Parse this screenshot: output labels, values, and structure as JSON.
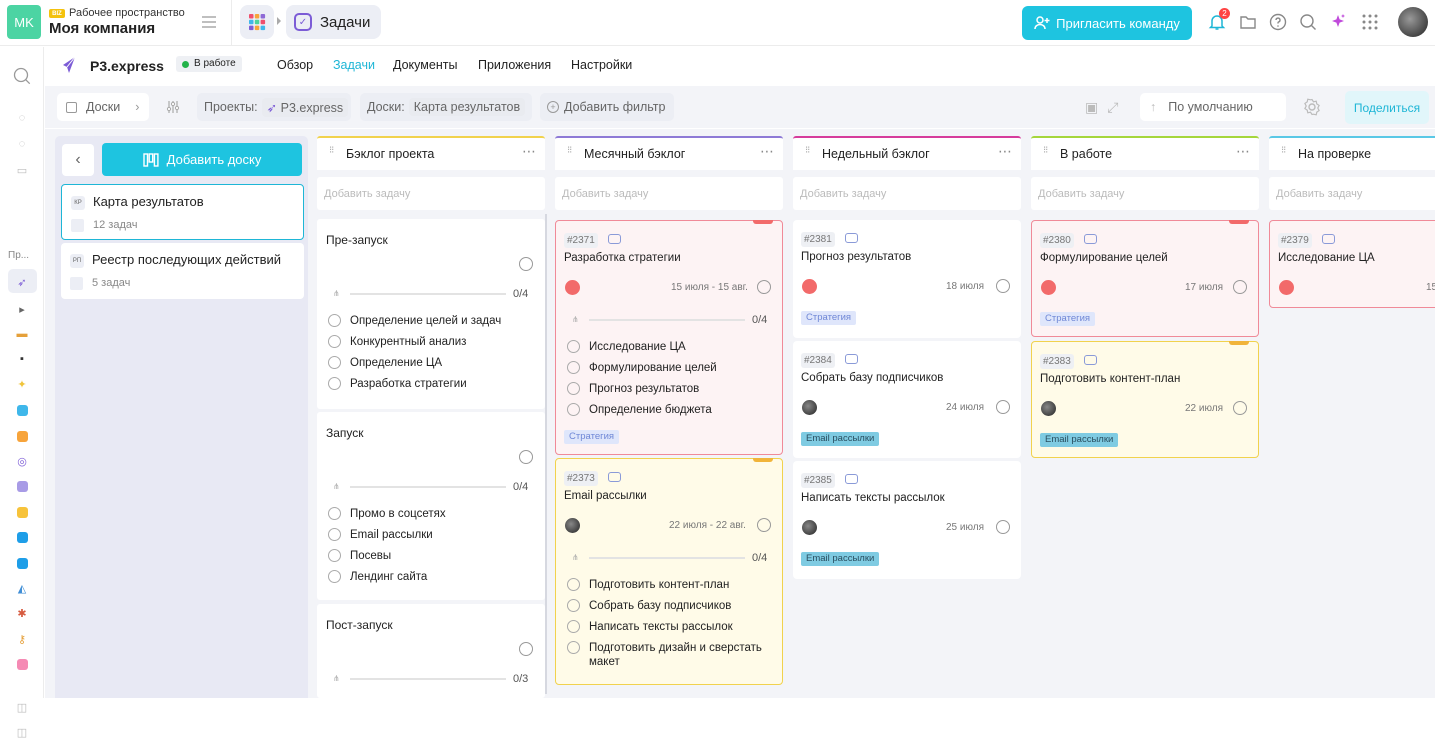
{
  "topbar": {
    "avatar_initials": "MK",
    "ws_badge": "BIZ",
    "ws_label": "Рабочее пространство",
    "ws_name": "Моя компания",
    "section_title": "Задачи",
    "invite_label": "Пригласить команду",
    "notif_count": "2",
    "accent": "#1ec4e0"
  },
  "rail": {
    "label": "Пр..."
  },
  "project": {
    "name": "P3.express",
    "status": "В работе",
    "tabs": [
      {
        "label": "Обзор"
      },
      {
        "label": "Задачи"
      },
      {
        "label": "Документы"
      },
      {
        "label": "Приложения"
      },
      {
        "label": "Настройки"
      }
    ]
  },
  "filters": {
    "boards_label": "Доски",
    "projects_label": "Проекты:",
    "projects_value": "P3.express",
    "boards_filter_label": "Доски:",
    "boards_filter_value": "Карта результатов",
    "add_filter": "Добавить фильтр",
    "sort": "По умолчанию",
    "share": "Поделиться"
  },
  "boards_panel": {
    "add_board": "Добавить доску",
    "items": [
      {
        "abbr": "КР",
        "title": "Карта результатов",
        "count": "12 задач"
      },
      {
        "abbr": "РП",
        "title": "Реестр последующих действий",
        "count": "5 задач"
      }
    ]
  },
  "add_task_placeholder": "Добавить задачу",
  "columns": [
    {
      "name": "Бэклог проекта",
      "color": "#f1d24d"
    },
    {
      "name": "Месячный бэклог",
      "color": "#8e7ad6"
    },
    {
      "name": "Недельный бэклог",
      "color": "#d63c9c"
    },
    {
      "name": "В работе",
      "color": "#a5d63c"
    },
    {
      "name": "На проверке",
      "color": "#5ac8e6"
    }
  ],
  "backlog_groups": [
    {
      "title": "Пре-запуск",
      "progress": "0/4",
      "items": [
        "Определение целей и задач",
        "Конкурентный анализ",
        "Определение ЦА",
        "Разработка стратегии"
      ]
    },
    {
      "title": "Запуск",
      "progress": "0/4",
      "items": [
        "Промо в соцсетях",
        "Email рассылки",
        "Посевы",
        "Лендинг сайта"
      ]
    },
    {
      "title": "Пост-запуск",
      "progress": "0/3",
      "items": []
    }
  ],
  "monthly_cards": [
    {
      "num": "#2371",
      "title": "Разработка стратегии",
      "date": "15 июля - 15 авг.",
      "progress": "0/4",
      "subs": [
        "Исследование ЦА",
        "Формулирование целей",
        "Прогноз результатов",
        "Определение бюджета"
      ],
      "tag": "Стратегия"
    },
    {
      "num": "#2373",
      "title": "Email рассылки",
      "date": "22 июля - 22 авг.",
      "progress": "0/4",
      "subs": [
        "Подготовить контент-план",
        "Собрать базу подписчиков",
        "Написать тексты рассылок",
        "Подготовить дизайн и сверстать макет"
      ]
    }
  ],
  "weekly_cards": [
    {
      "num": "#2381",
      "title": "Прогноз результатов",
      "date": "18 июля",
      "tag": "Стратегия"
    },
    {
      "num": "#2384",
      "title": "Собрать базу подписчиков",
      "date": "24 июля",
      "tag": "Email рассылки"
    },
    {
      "num": "#2385",
      "title": "Написать тексты рассылок",
      "date": "25 июля",
      "tag": "Email рассылки"
    }
  ],
  "inwork_cards": [
    {
      "num": "#2380",
      "title": "Формулирование целей",
      "date": "17 июля",
      "tag": "Стратегия"
    },
    {
      "num": "#2383",
      "title": "Подготовить контент-план",
      "date": "22 июля",
      "tag": "Email рассылки"
    }
  ],
  "review_cards": [
    {
      "num": "#2379",
      "title": "Исследование ЦА",
      "date": "15"
    }
  ]
}
